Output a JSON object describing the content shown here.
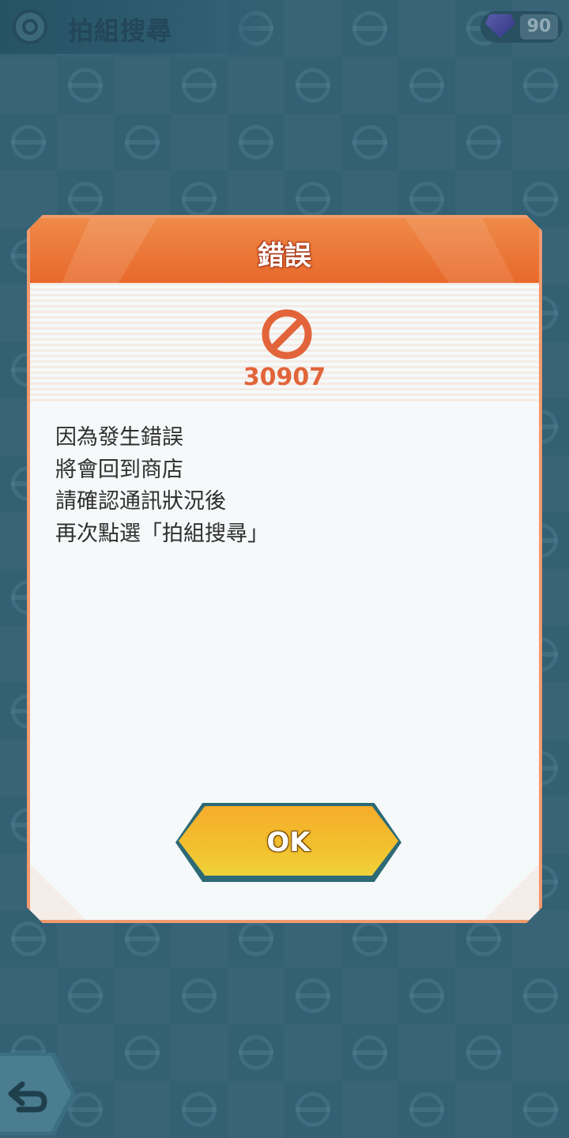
{
  "header": {
    "title": "拍組搜尋",
    "gem_count": "90"
  },
  "dialog": {
    "title": "錯誤",
    "error_code": "30907",
    "message_lines": [
      "因為發生錯誤",
      "將會回到商店",
      "請確認通訊狀況後",
      "再次點選「拍組搜尋」"
    ],
    "ok_label": "OK"
  },
  "icons": {
    "top_left": "unite-search-icon",
    "currency": "gem-icon",
    "error": "prohibited-icon",
    "back": "back-arrow-icon"
  },
  "colors": {
    "header_orange": "#e8692b",
    "error_red": "#e2643a",
    "button_yellow": "#f2c12e",
    "background_teal": "#3f6f82"
  }
}
